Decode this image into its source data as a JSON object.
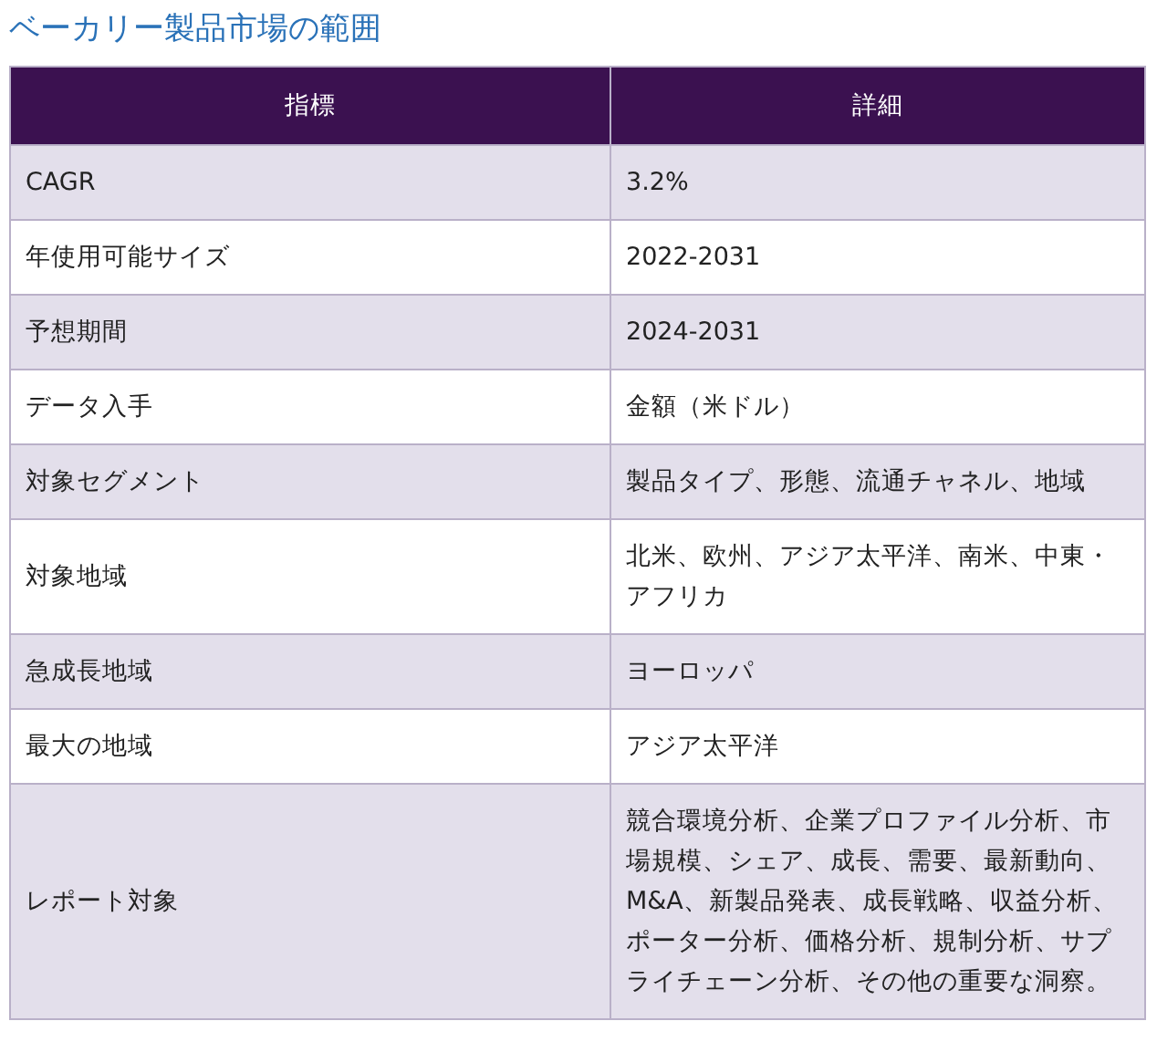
{
  "title": "ベーカリー製品市場の範囲",
  "table": {
    "columns": [
      "指標",
      "詳細"
    ],
    "rows": [
      {
        "label": "CAGR",
        "value": "3.2%"
      },
      {
        "label": "年使用可能サイズ",
        "value": "2022-2031"
      },
      {
        "label": "予想期間",
        "value": "2024-2031"
      },
      {
        "label": "データ入手",
        "value": "金額（米ドル）"
      },
      {
        "label": "対象セグメント",
        "value": "製品タイプ、形態、流通チャネル、地域"
      },
      {
        "label": "対象地域",
        "value": "北米、欧州、アジア太平洋、南米、中東・アフリカ"
      },
      {
        "label": "急成長地域",
        "value": "ヨーロッパ"
      },
      {
        "label": "最大の地域",
        "value": "アジア太平洋"
      },
      {
        "label": "レポート対象",
        "value": "競合環境分析、企業プロファイル分析、市場規模、シェア、成長、需要、最新動向、M&A、新製品発表、成長戦略、収益分析、ポーター分析、価格分析、規制分析、サプライチェーン分析、その他の重要な洞察。"
      }
    ]
  }
}
